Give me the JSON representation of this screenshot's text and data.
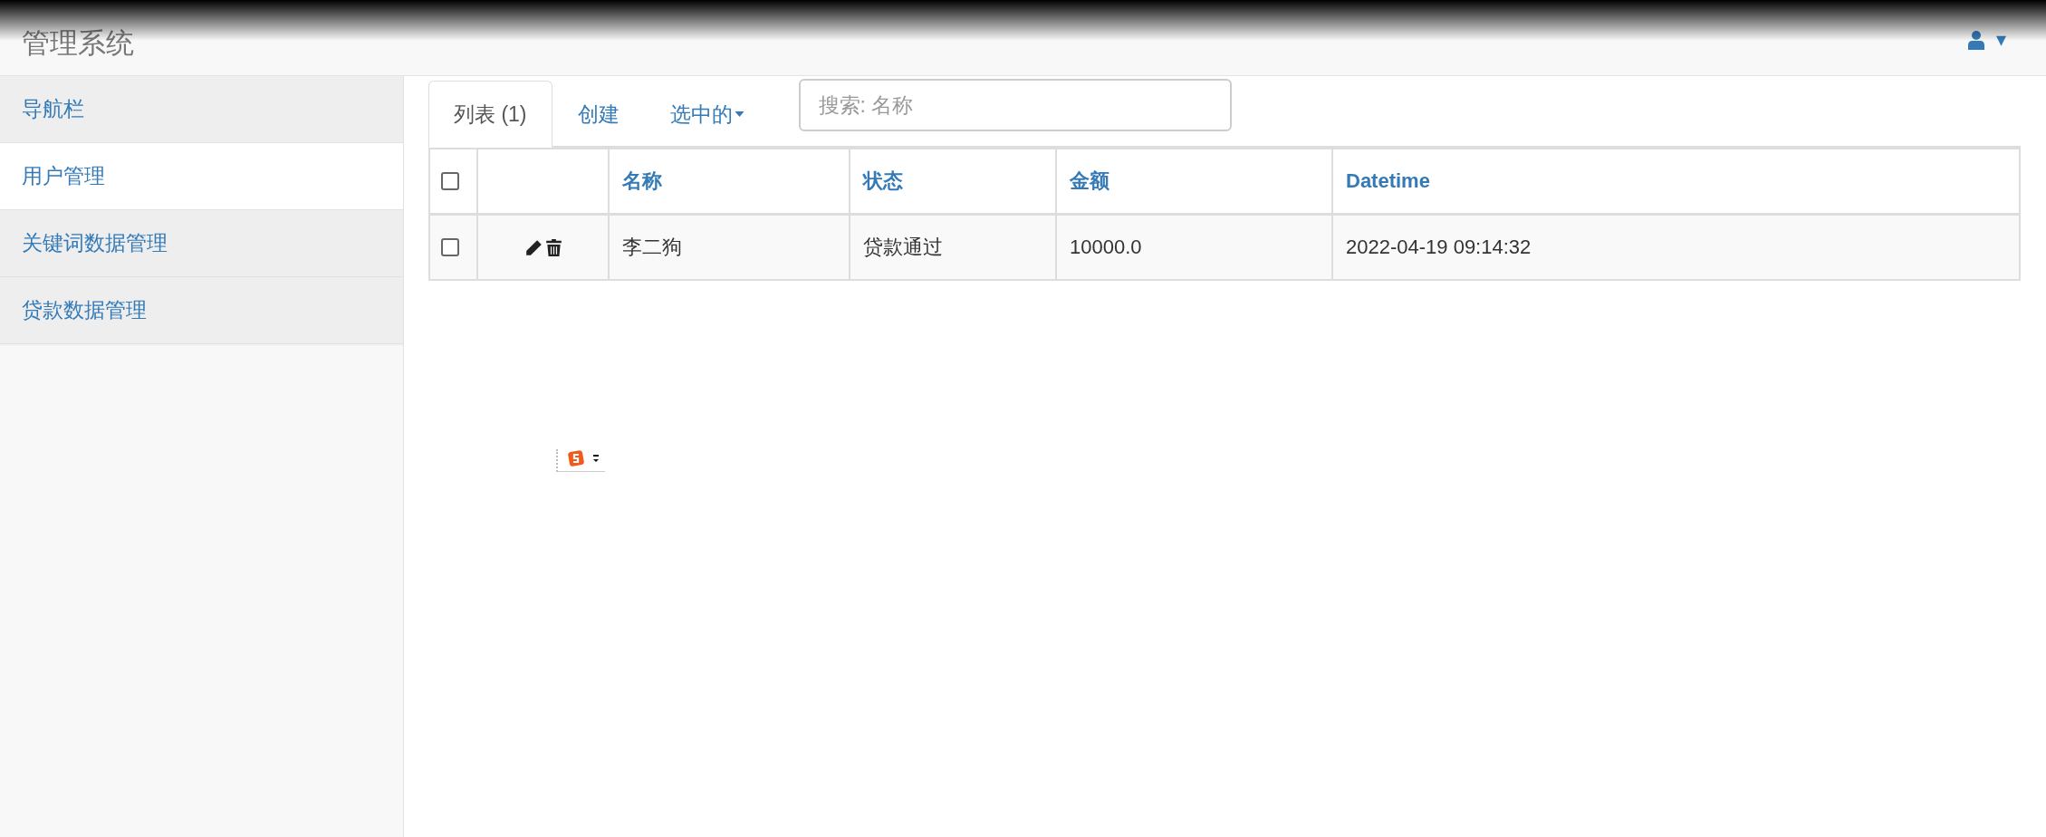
{
  "navbar": {
    "brand": "管理系统",
    "user_menu": {
      "caret": "▾"
    }
  },
  "sidebar": {
    "items": [
      {
        "label": "导航栏",
        "highlighted": true
      },
      {
        "label": "用户管理",
        "highlighted": false
      },
      {
        "label": "关键词数据管理",
        "highlighted": true
      },
      {
        "label": "贷款数据管理",
        "highlighted": true
      }
    ]
  },
  "tabs": [
    {
      "label": "列表 (1)",
      "selected": true,
      "kind": "tab"
    },
    {
      "label": "创建",
      "selected": false,
      "kind": "tab"
    },
    {
      "label": "选中的",
      "selected": false,
      "kind": "dropdown"
    }
  ],
  "search": {
    "placeholder": "搜索: 名称"
  },
  "table": {
    "select_all": {
      "checked": false
    },
    "columns": [
      "名称",
      "状态",
      "金额",
      "Datetime"
    ],
    "rows": [
      {
        "checked": false,
        "cells": [
          "李二狗",
          "贷款通过",
          "10000.0",
          "2022-04-19 09:14:32"
        ]
      }
    ]
  }
}
